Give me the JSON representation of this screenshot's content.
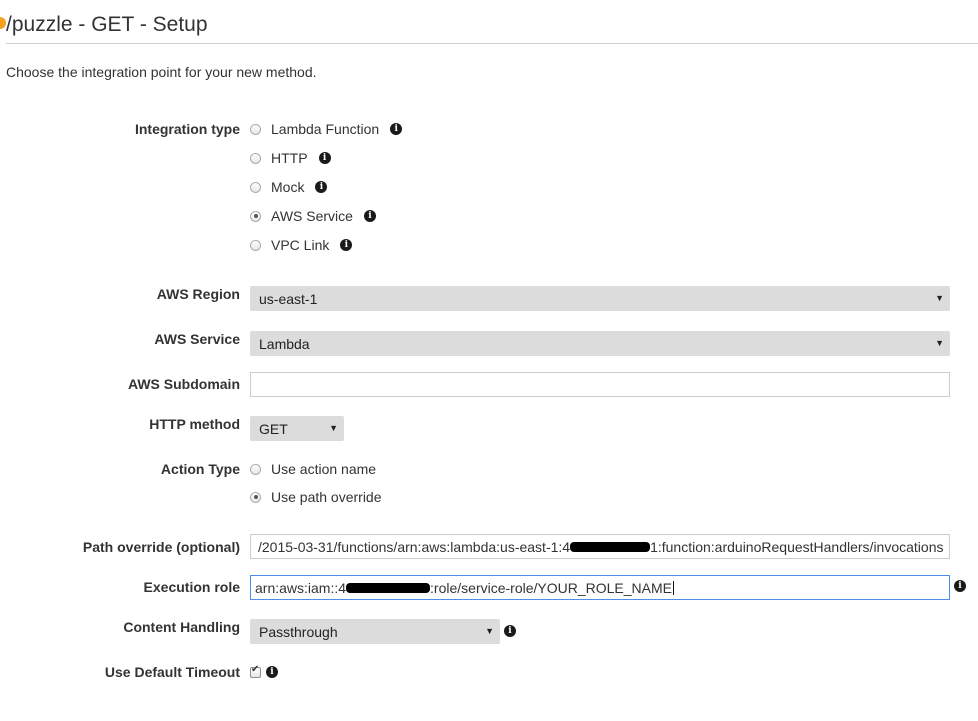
{
  "page": {
    "title": "/puzzle - GET - Setup",
    "subtitle": "Choose the integration point for your new method."
  },
  "integration_type": {
    "label": "Integration type",
    "options": [
      {
        "label": "Lambda Function",
        "checked": false
      },
      {
        "label": "HTTP",
        "checked": false
      },
      {
        "label": "Mock",
        "checked": false
      },
      {
        "label": "AWS Service",
        "checked": true
      },
      {
        "label": "VPC Link",
        "checked": false
      }
    ]
  },
  "aws_region": {
    "label": "AWS Region",
    "value": "us-east-1"
  },
  "aws_service": {
    "label": "AWS Service",
    "value": "Lambda"
  },
  "aws_subdomain": {
    "label": "AWS Subdomain",
    "value": ""
  },
  "http_method": {
    "label": "HTTP method",
    "value": "GET"
  },
  "action_type": {
    "label": "Action Type",
    "options": [
      {
        "label": "Use action name",
        "checked": false
      },
      {
        "label": "Use path override",
        "checked": true
      }
    ]
  },
  "path_override": {
    "label": "Path override (optional)",
    "value_prefix": "/2015-03-31/functions/arn:aws:lambda:us-east-1:4",
    "value_suffix": "1:function:arduinoRequestHandlers/invocations"
  },
  "execution_role": {
    "label": "Execution role",
    "value_prefix": "arn:aws:iam::4",
    "value_suffix": ":role/service-role/YOUR_ROLE_NAME"
  },
  "content_handling": {
    "label": "Content Handling",
    "value": "Passthrough"
  },
  "default_timeout": {
    "label": "Use Default Timeout",
    "checked": true
  },
  "colors": {
    "accent": "#f7a01d",
    "focus_border": "#4f8ee8",
    "select_bg": "#dcdcdc"
  },
  "icons": {
    "info": "info-icon",
    "caret": "dropdown-caret-icon"
  }
}
